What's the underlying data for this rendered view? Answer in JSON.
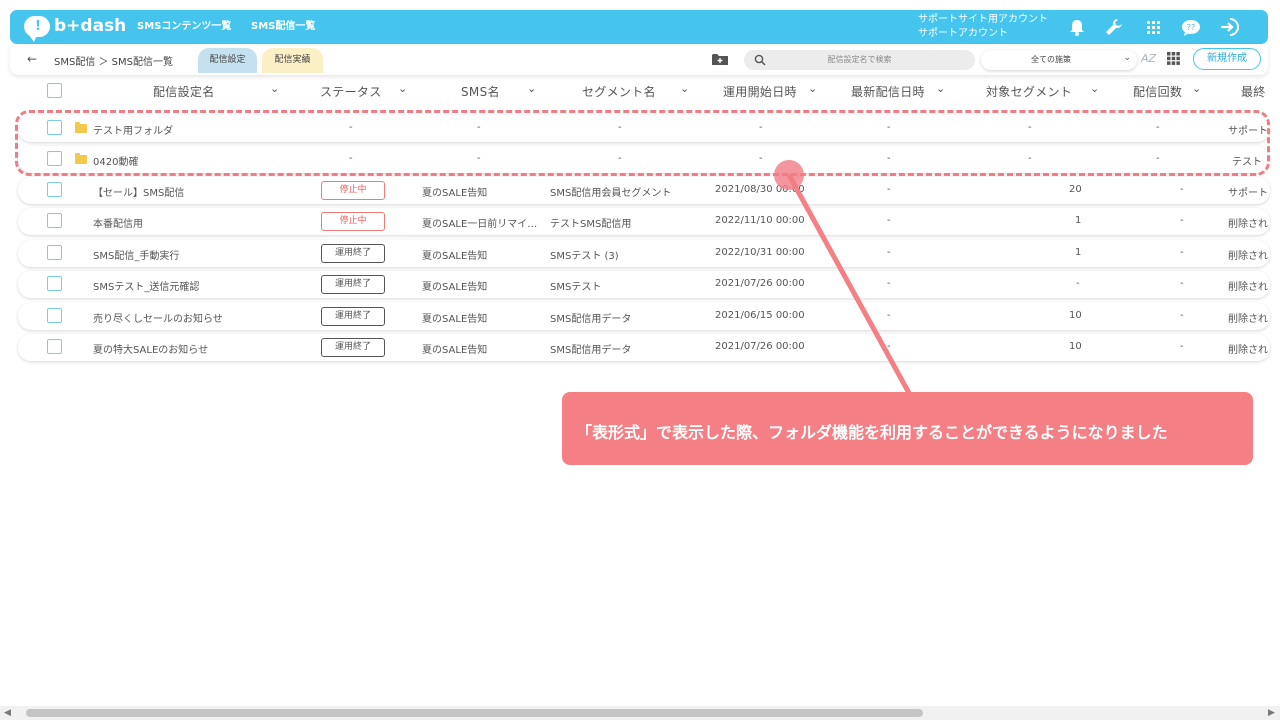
{
  "topbar": {
    "logo_text": "b+dash",
    "nav": [
      "SMSコンテンツ一覧",
      "SMS配信一覧"
    ],
    "account_line1": "サポートサイト用アカウント",
    "account_line2": "サポートアカウント",
    "icons": [
      "bell-icon",
      "wrench-icon",
      "apps-grid-icon",
      "help-chat-icon",
      "logout-icon"
    ],
    "color": "#45c4ee"
  },
  "subbar": {
    "back": "←",
    "breadcrumb": "SMS配信 ＞ SMS配信一覧",
    "tabs": [
      "配信設定",
      "配信実績"
    ],
    "search_placeholder": "配信設定名で検索",
    "select_value": "全ての施策",
    "az_label": "AZ",
    "new_button": "新規作成"
  },
  "columns": [
    "配信設定名",
    "ステータス",
    "SMS名",
    "セグメント名",
    "運用開始日時",
    "最新配信日時",
    "対象セグメント",
    "配信回数",
    "最終"
  ],
  "folders": [
    {
      "name": "テスト用フォルダ",
      "status": "-",
      "sms": "-",
      "segment": "-",
      "start": "-",
      "latest": "-",
      "target": "-",
      "count": "-",
      "last": "サポート"
    },
    {
      "name": "0420動確",
      "status": "-",
      "sms": "-",
      "segment": "-",
      "start": "-",
      "latest": "-",
      "target": "-",
      "count": "-",
      "last": "テスト"
    }
  ],
  "rows": [
    {
      "name": "【セール】SMS配信",
      "status": "停止中",
      "status_type": "stop",
      "sms": "夏のSALE告知",
      "segment": "SMS配信用会員セグメント",
      "start": "2021/08/30 00:00",
      "latest": "-",
      "target": "20",
      "count": "-",
      "last": "サポート"
    },
    {
      "name": "本番配信用",
      "status": "停止中",
      "status_type": "stop",
      "sms": "夏のSALE一日前リマイ…",
      "segment": "テストSMS配信用",
      "start": "2022/11/10 00:00",
      "latest": "-",
      "target": "1",
      "count": "-",
      "last": "削除され"
    },
    {
      "name": "SMS配信_手動実行",
      "status": "運用終了",
      "status_type": "end",
      "sms": "夏のSALE告知",
      "segment": "SMSテスト (3)",
      "start": "2022/10/31 00:00",
      "latest": "-",
      "target": "1",
      "count": "-",
      "last": "削除され"
    },
    {
      "name": "SMSテスト_送信元確認",
      "status": "運用終了",
      "status_type": "end",
      "sms": "夏のSALE告知",
      "segment": "SMSテスト",
      "start": "2021/07/26 00:00",
      "latest": "-",
      "target": "-",
      "count": "-",
      "last": "削除され"
    },
    {
      "name": "売り尽くしセールのお知らせ",
      "status": "運用終了",
      "status_type": "end",
      "sms": "夏のSALE告知",
      "segment": "SMS配信用データ",
      "start": "2021/06/15 00:00",
      "latest": "-",
      "target": "10",
      "count": "-",
      "last": "削除され"
    },
    {
      "name": "夏の特大SALEのお知らせ",
      "status": "運用終了",
      "status_type": "end",
      "sms": "夏のSALE告知",
      "segment": "SMS配信用データ",
      "start": "2021/07/26 00:00",
      "latest": "-",
      "target": "10",
      "count": "-",
      "last": "削除され"
    }
  ],
  "annotation": {
    "text": "「表形式」で表示した際、フォルダ機能を利用することができるようになりました",
    "color": "#f47f84"
  },
  "scrollbar": {
    "left": "◀",
    "right": "▶"
  }
}
